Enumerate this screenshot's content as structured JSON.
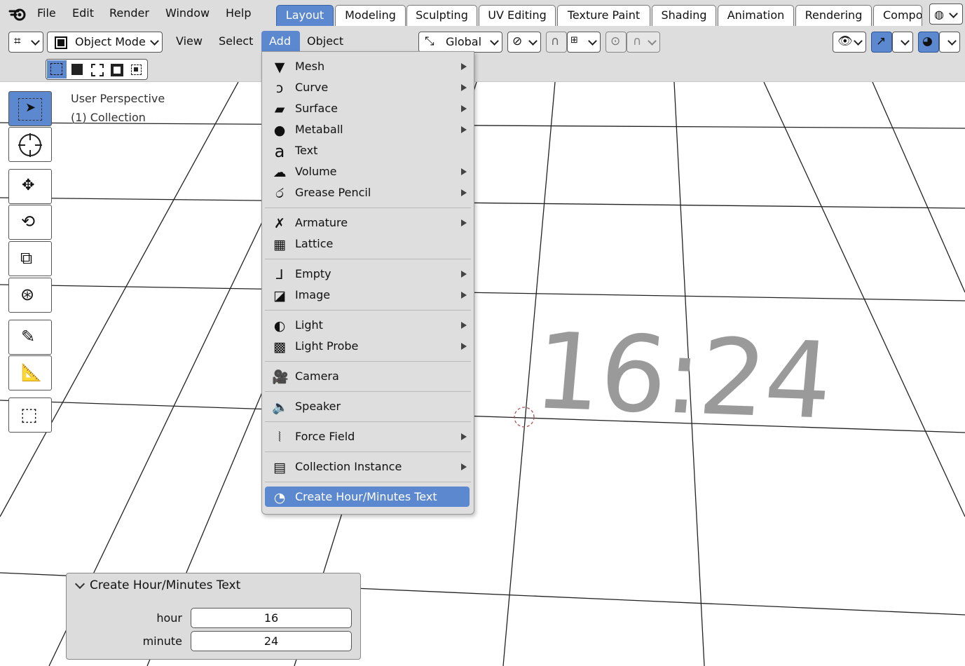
{
  "app_menu": {
    "file": "File",
    "edit": "Edit",
    "render": "Render",
    "window": "Window",
    "help": "Help"
  },
  "workspace_tabs": [
    {
      "label": "Layout",
      "active": true
    },
    {
      "label": "Modeling"
    },
    {
      "label": "Sculpting"
    },
    {
      "label": "UV Editing"
    },
    {
      "label": "Texture Paint"
    },
    {
      "label": "Shading"
    },
    {
      "label": "Animation"
    },
    {
      "label": "Rendering"
    },
    {
      "label": "Compo"
    }
  ],
  "header": {
    "mode": "Object Mode",
    "view": "View",
    "select": "Select",
    "add": "Add",
    "object": "Object",
    "orientation": "Global"
  },
  "viewport": {
    "perspective": "User Perspective",
    "collection": "(1) Collection",
    "clock_text": "16:24"
  },
  "add_menu": {
    "items": [
      {
        "icon": "mesh-icon",
        "label": "Mesh",
        "submenu": true
      },
      {
        "icon": "curve-icon",
        "label": "Curve",
        "submenu": true
      },
      {
        "icon": "surface-icon",
        "label": "Surface",
        "submenu": true
      },
      {
        "icon": "metaball-icon",
        "label": "Metaball",
        "submenu": true
      },
      {
        "icon": "text-icon",
        "label": "Text",
        "submenu": false
      },
      {
        "icon": "volume-icon",
        "label": "Volume",
        "submenu": true
      },
      {
        "icon": "grease-pencil-icon",
        "label": "Grease Pencil",
        "submenu": true
      },
      {
        "icon": "armature-icon",
        "label": "Armature",
        "submenu": true
      },
      {
        "icon": "lattice-icon",
        "label": "Lattice",
        "submenu": false
      },
      {
        "icon": "empty-icon",
        "label": "Empty",
        "submenu": true
      },
      {
        "icon": "image-icon",
        "label": "Image",
        "submenu": true
      },
      {
        "icon": "light-icon",
        "label": "Light",
        "submenu": true
      },
      {
        "icon": "light-probe-icon",
        "label": "Light Probe",
        "submenu": true
      },
      {
        "icon": "camera-icon",
        "label": "Camera",
        "submenu": false
      },
      {
        "icon": "speaker-icon",
        "label": "Speaker",
        "submenu": false
      },
      {
        "icon": "force-field-icon",
        "label": "Force Field",
        "submenu": true
      },
      {
        "icon": "collection-instance-icon",
        "label": "Collection Instance",
        "submenu": true
      },
      {
        "icon": "clock-icon",
        "label": "Create Hour/Minutes Text",
        "submenu": false,
        "highlighted": true
      }
    ]
  },
  "redo_panel": {
    "title": "Create Hour/Minutes Text",
    "hour_label": "hour",
    "hour_value": "16",
    "minute_label": "minute",
    "minute_value": "24"
  },
  "colors": {
    "accent": "#5b88cf",
    "menu_bg": "#dedede",
    "bar_bg": "#dddddd"
  }
}
